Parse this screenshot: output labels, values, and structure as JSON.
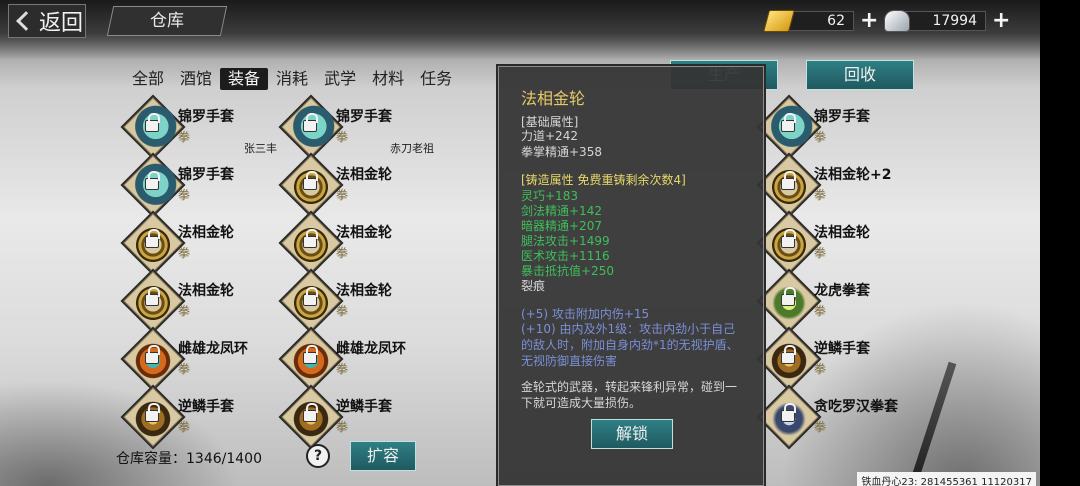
{
  "header": {
    "back_label": "返回",
    "title": "仓库",
    "gold": "62",
    "silver": "17994"
  },
  "tabs": [
    {
      "label": "全部",
      "active": false
    },
    {
      "label": "酒馆",
      "active": false
    },
    {
      "label": "装备",
      "active": true
    },
    {
      "label": "消耗",
      "active": false
    },
    {
      "label": "武学",
      "active": false
    },
    {
      "label": "材料",
      "active": false
    },
    {
      "label": "任务",
      "active": false
    }
  ],
  "buttons": {
    "produce": "生产",
    "recycle": "回收",
    "expand": "扩容",
    "unlock": "解锁",
    "help": "?"
  },
  "items": [
    {
      "name": "锦罗手套",
      "type": "拳",
      "art": "glove",
      "owner": ""
    },
    {
      "name": "锦罗手套",
      "type": "拳",
      "art": "glove",
      "owner": "张三丰"
    },
    {
      "name": "锦罗手套",
      "type": "拳",
      "art": "glove",
      "owner": "赤刀老祖"
    },
    {
      "name": "锦罗手套",
      "type": "拳",
      "art": "glove",
      "owner": ""
    },
    {
      "name": "法相金轮",
      "type": "拳",
      "art": "wheel",
      "owner": ""
    },
    {
      "name": "法相金轮+2",
      "type": "拳",
      "art": "wheel",
      "owner": ""
    },
    {
      "name": "法相金轮",
      "type": "拳",
      "art": "wheel",
      "owner": ""
    },
    {
      "name": "法相金轮",
      "type": "拳",
      "art": "wheel",
      "owner": ""
    },
    {
      "name": "法相金轮",
      "type": "拳",
      "art": "wheel",
      "owner": ""
    },
    {
      "name": "法相金轮",
      "type": "拳",
      "art": "wheel",
      "owner": ""
    },
    {
      "name": "法相金轮",
      "type": "拳",
      "art": "wheel",
      "owner": ""
    },
    {
      "name": "龙虎拳套",
      "type": "拳",
      "art": "tiger",
      "owner": ""
    },
    {
      "name": "雌雄龙凤环",
      "type": "拳",
      "art": "claw",
      "owner": ""
    },
    {
      "name": "雌雄龙凤环",
      "type": "拳",
      "art": "claw",
      "owner": ""
    },
    {
      "name": "逆鳞手套",
      "type": "拳",
      "art": "scale",
      "owner": ""
    },
    {
      "name": "逆鳞手套",
      "type": "拳",
      "art": "scale",
      "owner": ""
    },
    {
      "name": "逆鳞手套",
      "type": "拳",
      "art": "scale",
      "owner": ""
    },
    {
      "name": "贪吃罗汉拳套",
      "type": "拳",
      "art": "luohan",
      "owner": ""
    }
  ],
  "tooltip": {
    "title": "法相金轮",
    "base_header": "[基础属性]",
    "base_stats": [
      "力道+242",
      "拳掌精通+358"
    ],
    "forge_header": "[铸造属性 免费重铸剩余次数4]",
    "forge_stats": [
      "灵巧+183",
      "剑法精通+142",
      "暗器精通+207",
      "腿法攻击+1499",
      "医术攻击+1116",
      "暴击抵抗值+250"
    ],
    "crack": "裂痕",
    "effect1": "(+5) 攻击附加内伤+15",
    "effect2": "(+10) 由内及外1级：攻击内劲小于自己的敌人时，附加自身内劲*1的无视护盾、无视防御直接伤害",
    "description": "金轮式的武器，转起来锋利异常，碰到一下就可造成大量损伤。"
  },
  "footer": {
    "capacity_label": "仓库容量：",
    "capacity_value": "1346/1400",
    "id_text": "铁血丹心23: 281455361  11120317"
  },
  "colors": {
    "teal_button": "#2f7f84",
    "gold_text": "#e8c96a",
    "green_stat": "#3fbf5a",
    "blue_effect": "#7a8fd6"
  }
}
